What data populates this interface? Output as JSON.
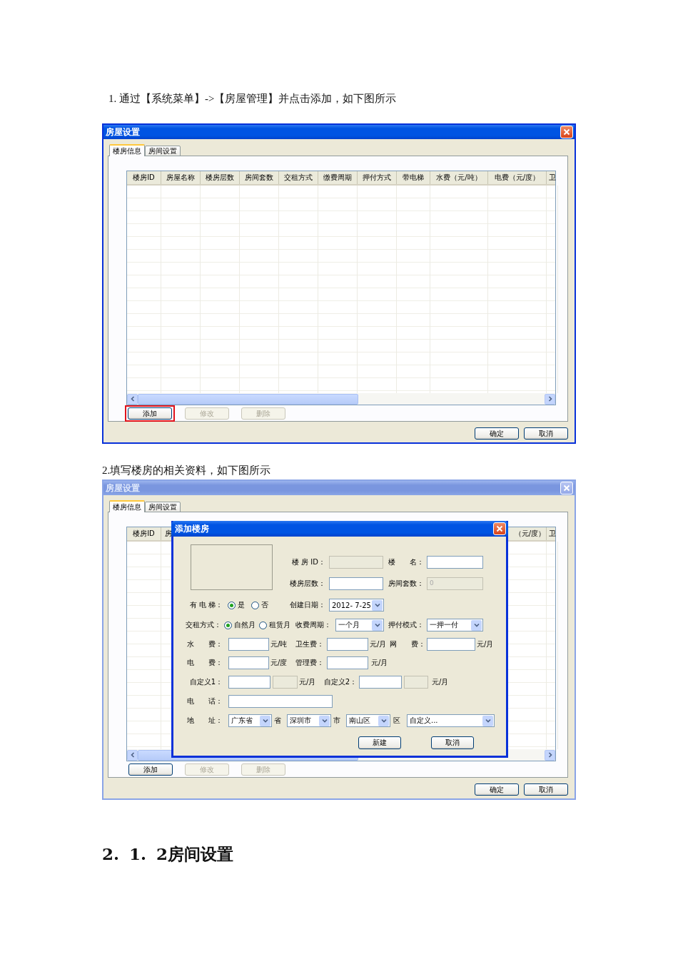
{
  "figures": [
    {
      "caption": "1. 通过【系统菜单】->【房屋管理】并点击添加，如下图所示",
      "window": {
        "title": "房屋设置",
        "active": true,
        "tabs": [
          {
            "label": "楼房信息",
            "selected": true
          },
          {
            "label": "房间设置",
            "selected": false
          }
        ],
        "table": {
          "columns": [
            {
              "label": "楼房ID"
            },
            {
              "label": "房屋名称"
            },
            {
              "label": "楼房层数"
            },
            {
              "label": "房间套数"
            },
            {
              "label": "交租方式"
            },
            {
              "label": "缴费周期"
            },
            {
              "label": "押付方式"
            },
            {
              "label": "带电梯"
            },
            {
              "label": "水费（元/吨）"
            },
            {
              "label": "电费（元/度）"
            },
            {
              "label": "卫"
            }
          ]
        },
        "buttons": [
          {
            "label": "添加",
            "disabled": false,
            "highlighted": true
          },
          {
            "label": "修改",
            "disabled": true,
            "highlighted": false
          },
          {
            "label": "删除",
            "disabled": true,
            "highlighted": false
          }
        ],
        "footer_buttons": [
          {
            "label": "确定"
          },
          {
            "label": "取消"
          }
        ]
      }
    },
    {
      "caption": "2.填写楼房的相关资料，如下图所示",
      "window": {
        "title": "房屋设置",
        "active": false,
        "tabs": [
          {
            "label": "楼房信息",
            "selected": true
          },
          {
            "label": "房间设置",
            "selected": false
          }
        ],
        "table": {
          "columns": [
            {
              "label": "楼房ID"
            },
            {
              "label": "房"
            },
            {
              "label": "（元/度）"
            },
            {
              "label": "卫"
            }
          ]
        },
        "buttons": [
          {
            "label": "添加",
            "disabled": false,
            "highlighted": false
          },
          {
            "label": "修改",
            "disabled": true,
            "highlighted": false
          },
          {
            "label": "删除",
            "disabled": true,
            "highlighted": false
          }
        ],
        "footer_buttons": [
          {
            "label": "确定"
          },
          {
            "label": "取消"
          }
        ],
        "dialog": {
          "title": "添加楼房",
          "rows": [
            {
              "items": [
                {
                  "kind": "label",
                  "text": "楼 房 ID："
                },
                {
                  "kind": "input",
                  "disabled": true
                },
                {
                  "kind": "label",
                  "text": "楼　　名："
                },
                {
                  "kind": "input",
                  "disabled": false
                }
              ]
            },
            {
              "items": [
                {
                  "kind": "label",
                  "text": "楼房层数："
                },
                {
                  "kind": "input",
                  "disabled": false
                },
                {
                  "kind": "label",
                  "text": "房间套数："
                },
                {
                  "kind": "input",
                  "disabled": true,
                  "value": "0"
                }
              ]
            },
            {
              "items": [
                {
                  "kind": "label",
                  "text": "有 电 梯："
                },
                {
                  "kind": "radio",
                  "text": "是",
                  "selected": true
                },
                {
                  "kind": "radio",
                  "text": "否",
                  "selected": false
                },
                {
                  "kind": "label",
                  "text": "创建日期："
                },
                {
                  "kind": "select",
                  "value": "2012- 7-25"
                }
              ]
            },
            {
              "items": [
                {
                  "kind": "label",
                  "text": "交租方式："
                },
                {
                  "kind": "radio",
                  "text": "自然月",
                  "selected": true
                },
                {
                  "kind": "radio",
                  "text": "租赁月",
                  "selected": false
                },
                {
                  "kind": "label",
                  "text": "收费周期："
                },
                {
                  "kind": "select",
                  "value": "一个月"
                },
                {
                  "kind": "label",
                  "text": "押付模式："
                },
                {
                  "kind": "select",
                  "value": "一押一付"
                }
              ]
            },
            {
              "items": [
                {
                  "kind": "label",
                  "text": "水　　费："
                },
                {
                  "kind": "input",
                  "disabled": false
                },
                {
                  "kind": "unit",
                  "text": "元/吨"
                },
                {
                  "kind": "label",
                  "text": "卫生费："
                },
                {
                  "kind": "input",
                  "disabled": false
                },
                {
                  "kind": "unit",
                  "text": "元/月"
                },
                {
                  "kind": "label",
                  "text": "网　　费："
                },
                {
                  "kind": "input",
                  "disabled": false
                },
                {
                  "kind": "unit",
                  "text": "元/月"
                }
              ]
            },
            {
              "items": [
                {
                  "kind": "label",
                  "text": "电　　费："
                },
                {
                  "kind": "input",
                  "disabled": false
                },
                {
                  "kind": "unit",
                  "text": "元/度"
                },
                {
                  "kind": "label",
                  "text": "管理费："
                },
                {
                  "kind": "input",
                  "disabled": false
                },
                {
                  "kind": "unit",
                  "text": "元/月"
                }
              ]
            },
            {
              "items": [
                {
                  "kind": "label",
                  "text": "自定义1："
                },
                {
                  "kind": "input",
                  "disabled": false
                },
                {
                  "kind": "input",
                  "disabled": true
                },
                {
                  "kind": "unit",
                  "text": "元/月"
                },
                {
                  "kind": "label",
                  "text": "自定义2："
                },
                {
                  "kind": "input",
                  "disabled": false
                },
                {
                  "kind": "input",
                  "disabled": true
                },
                {
                  "kind": "unit",
                  "text": "元/月"
                }
              ]
            },
            {
              "items": [
                {
                  "kind": "label",
                  "text": "电　　话："
                },
                {
                  "kind": "input",
                  "disabled": false
                }
              ]
            },
            {
              "items": [
                {
                  "kind": "label",
                  "text": "地　　址："
                },
                {
                  "kind": "select",
                  "value": "广东省"
                },
                {
                  "kind": "unit",
                  "text": "省"
                },
                {
                  "kind": "select",
                  "value": "深圳市"
                },
                {
                  "kind": "unit",
                  "text": "市"
                },
                {
                  "kind": "select",
                  "value": "南山区"
                },
                {
                  "kind": "unit",
                  "text": "区"
                },
                {
                  "kind": "select",
                  "value": "自定义..."
                }
              ]
            }
          ],
          "buttons": [
            {
              "label": "新建"
            },
            {
              "label": "取消"
            }
          ]
        }
      }
    }
  ],
  "heading": "2. 1. 2房间设置"
}
